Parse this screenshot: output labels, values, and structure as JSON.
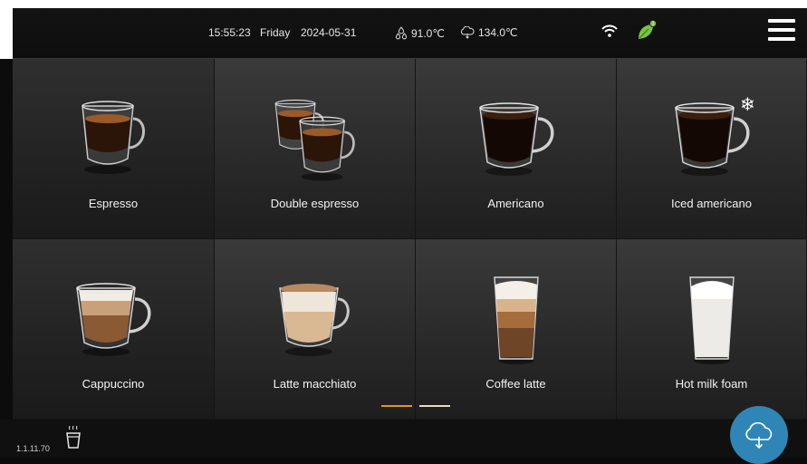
{
  "status": {
    "time": "15:55:23",
    "day": "Friday",
    "date": "2024-05-31",
    "water_temp": "91.0℃",
    "steam_temp": "134.0℃",
    "notification_count": "1"
  },
  "drinks": [
    {
      "label": "Espresso"
    },
    {
      "label": "Double espresso"
    },
    {
      "label": "Americano"
    },
    {
      "label": "Iced americano"
    },
    {
      "label": "Cappuccino"
    },
    {
      "label": "Latte macchiato"
    },
    {
      "label": "Coffee latte"
    },
    {
      "label": "Hot milk foam"
    }
  ],
  "iced_symbol": "❄",
  "pager": {
    "pages": 2,
    "current": 1
  },
  "footer": {
    "version": "1.1.11.70"
  },
  "colors": {
    "accent": "#2f86b6",
    "leaf": "#7cc242",
    "pager_active": "#d49a2a",
    "pager_inactive": "#e8dcc2"
  }
}
